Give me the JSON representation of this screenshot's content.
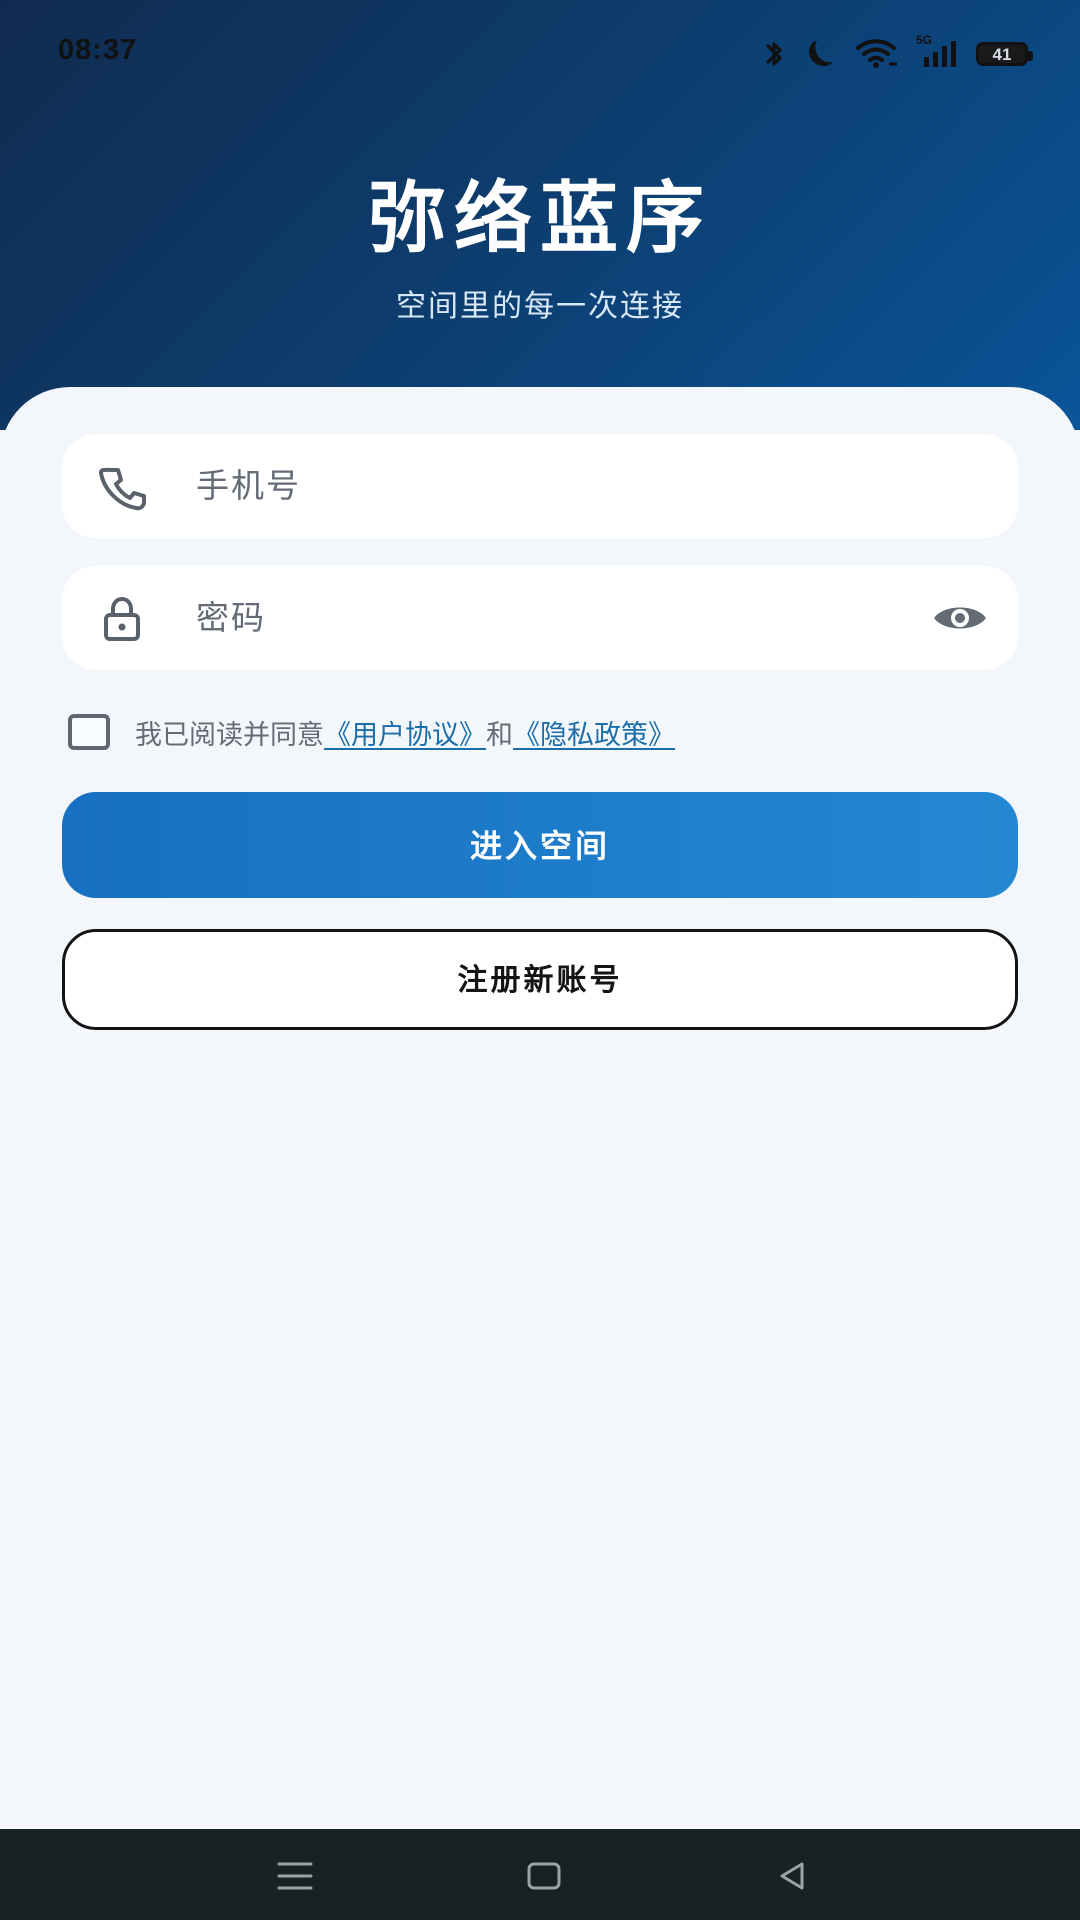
{
  "status": {
    "time": "08:37",
    "network_label": "5G",
    "battery_level": "41"
  },
  "header": {
    "title": "弥络蓝序",
    "subtitle": "空间里的每一次连接"
  },
  "form": {
    "phone_placeholder": "手机号",
    "password_placeholder": "密码",
    "agreement": {
      "prefix": "我已阅读并同意",
      "user_agreement": "《用户协议》",
      "connector": "和",
      "privacy_policy": "《隐私政策》"
    },
    "login_button": "进入空间",
    "register_button": "注册新账号"
  },
  "colors": {
    "header_start": "#102b4f",
    "header_end": "#0a5498",
    "primary_button": "#2388d1",
    "link": "#1c6ea9",
    "background": "#f3f7fc",
    "navigation_bar": "#172225"
  },
  "icons": {
    "bluetooth": "bluetooth-icon",
    "do_not_disturb": "moon-icon",
    "wifi": "wifi-icon",
    "signal": "cellular-signal-icon",
    "battery": "battery-icon",
    "phone": "phone-icon",
    "lock": "lock-icon",
    "visibility": "eye-icon",
    "menu": "menu-icon",
    "home": "home-icon",
    "back": "back-icon"
  }
}
